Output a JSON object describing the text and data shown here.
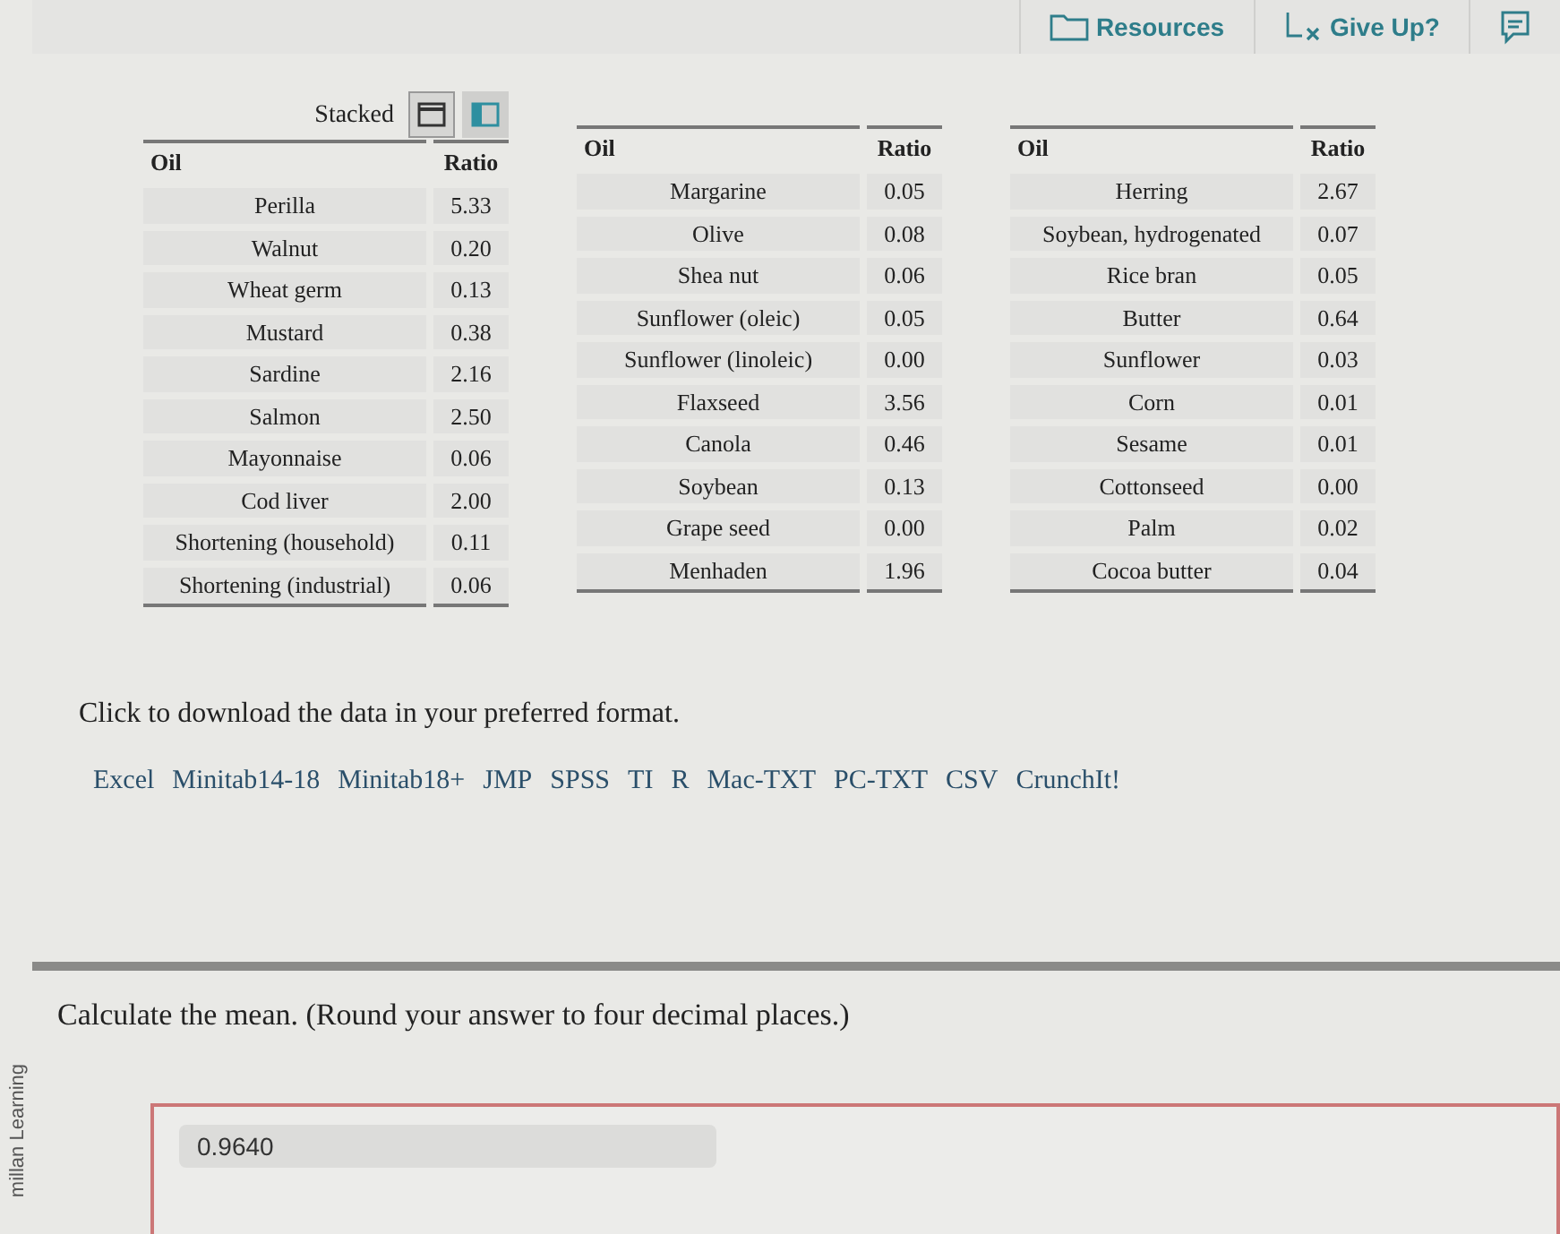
{
  "toolbar": {
    "buttons": [
      {
        "label": "Resources",
        "kind": "folder"
      },
      {
        "label": "Give Up?",
        "kind": "giveup"
      },
      {
        "kind": "feedback"
      }
    ]
  },
  "view_toggle": {
    "label": "Stacked",
    "options": [
      {
        "kind": "stacked",
        "selected": true
      },
      {
        "kind": "side",
        "selected": false
      }
    ]
  },
  "tables": [
    {
      "columns": [
        "Oil",
        "Ratio"
      ],
      "rows": [
        [
          "Perilla",
          "5.33"
        ],
        [
          "Walnut",
          "0.20"
        ],
        [
          "Wheat germ",
          "0.13"
        ],
        [
          "Mustard",
          "0.38"
        ],
        [
          "Sardine",
          "2.16"
        ],
        [
          "Salmon",
          "2.50"
        ],
        [
          "Mayonnaise",
          "0.06"
        ],
        [
          "Cod liver",
          "2.00"
        ],
        [
          "Shortening (household)",
          "0.11"
        ],
        [
          "Shortening (industrial)",
          "0.06"
        ]
      ]
    },
    {
      "columns": [
        "Oil",
        "Ratio"
      ],
      "rows": [
        [
          "Margarine",
          "0.05"
        ],
        [
          "Olive",
          "0.08"
        ],
        [
          "Shea nut",
          "0.06"
        ],
        [
          "Sunflower (oleic)",
          "0.05"
        ],
        [
          "Sunflower (linoleic)",
          "0.00"
        ],
        [
          "Flaxseed",
          "3.56"
        ],
        [
          "Canola",
          "0.46"
        ],
        [
          "Soybean",
          "0.13"
        ],
        [
          "Grape seed",
          "0.00"
        ],
        [
          "Menhaden",
          "1.96"
        ]
      ]
    },
    {
      "columns": [
        "Oil",
        "Ratio"
      ],
      "rows": [
        [
          "Herring",
          "2.67"
        ],
        [
          "Soybean, hydrogenated",
          "0.07"
        ],
        [
          "Rice bran",
          "0.05"
        ],
        [
          "Butter",
          "0.64"
        ],
        [
          "Sunflower",
          "0.03"
        ],
        [
          "Corn",
          "0.01"
        ],
        [
          "Sesame",
          "0.01"
        ],
        [
          "Cottonseed",
          "0.00"
        ],
        [
          "Palm",
          "0.02"
        ],
        [
          "Cocoa butter",
          "0.04"
        ]
      ]
    }
  ],
  "download": {
    "prompt": "Click to download the data in your preferred format.",
    "formats": [
      "Excel",
      "Minitab14-18",
      "Minitab18+",
      "JMP",
      "SPSS",
      "TI",
      "R",
      "Mac-TXT",
      "PC-TXT",
      "CSV",
      "CrunchIt!"
    ]
  },
  "side_label": "millan Learning",
  "question": {
    "text": "Calculate the mean. (Round your answer to four decimal places.)",
    "answer": "0.9640"
  }
}
